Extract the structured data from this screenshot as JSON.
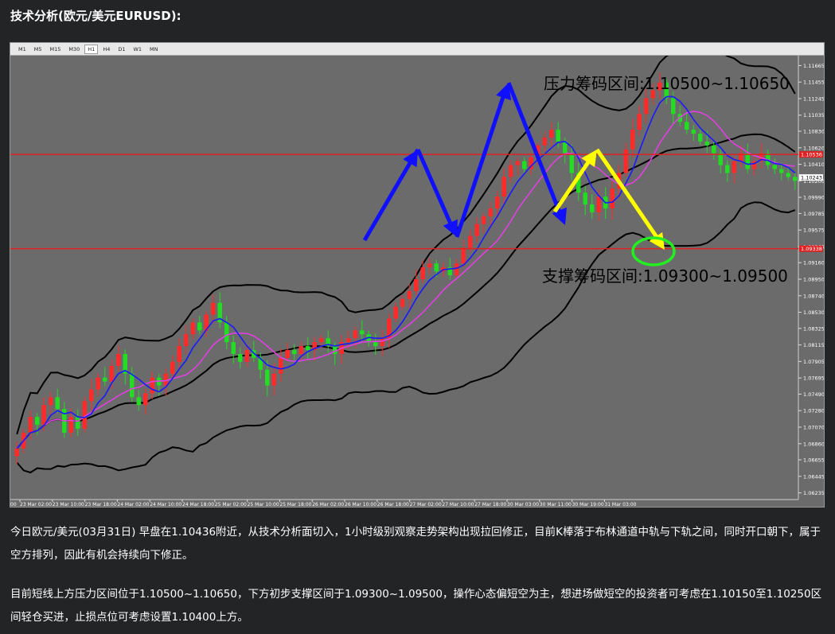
{
  "header": {
    "title": "技术分析(欧元/美元EURUSD):"
  },
  "toolbar": {
    "timeframes": [
      "M1",
      "M5",
      "M15",
      "M30",
      "H1",
      "H4",
      "D1",
      "W1",
      "MN"
    ],
    "active": "H1"
  },
  "chart_data": {
    "type": "candlestick",
    "symbol": "EURUSD",
    "timeframe": "H1",
    "ylim": [
      1.0615,
      1.1175
    ],
    "y_ticks": [
      "1.11665",
      "1.11455",
      "1.11245",
      "1.11035",
      "1.10830",
      "1.10620",
      "1.10410",
      "1.10200",
      "1.09990",
      "1.09785",
      "1.09575",
      "1.09365",
      "1.09160",
      "1.08950",
      "1.08740",
      "1.08530",
      "1.08325",
      "1.08115",
      "1.07905",
      "1.07695",
      "1.07490",
      "1.07280",
      "1.07070",
      "1.06860",
      "1.06655",
      "1.06445",
      "1.06235"
    ],
    "x_ticks": [
      "23 Mar 02:00",
      "23 Mar 10:00",
      "23 Mar 18:00",
      "24 Mar 02:00",
      "24 Mar 10:00",
      "24 Mar 18:00",
      "25 Mar 02:00",
      "25 Mar 10:00",
      "25 Mar 18:00",
      "26 Mar 02:00",
      "26 Mar 10:00",
      "26 Mar 18:00",
      "27 Mar 02:00",
      "27 Mar 10:00",
      "27 Mar 18:00",
      "30 Mar 03:00",
      "30 Mar 11:00",
      "30 Mar 19:00",
      "31 Mar 03:00"
    ],
    "first_x_label_partial": "00",
    "price_tags": [
      {
        "label": "1.10536",
        "value": 1.10536,
        "color": "#e02020"
      },
      {
        "label": "1.10243",
        "value": 1.10243,
        "color": "#ffffff"
      },
      {
        "label": "1.09338",
        "value": 1.09338,
        "color": "#e02020"
      }
    ],
    "horizontal_lines": [
      {
        "value": 1.10536,
        "color": "#e02020"
      },
      {
        "value": 1.09338,
        "color": "#e02020"
      }
    ],
    "resistance_zone": {
      "label": "压力筹码区间:1.10500~1.10650",
      "low": 1.105,
      "high": 1.1065
    },
    "support_zone": {
      "label": "支撑筹码区间:1.09300~1.09500",
      "low": 1.093,
      "high": 1.095
    },
    "closes": [
      1.068,
      1.07,
      1.072,
      1.071,
      1.0735,
      1.0745,
      1.073,
      1.07,
      1.072,
      1.0705,
      1.074,
      1.0755,
      1.077,
      1.0765,
      1.0785,
      1.08,
      1.0775,
      1.0745,
      1.0735,
      1.075,
      1.077,
      1.076,
      1.0775,
      1.079,
      1.081,
      1.0825,
      1.084,
      1.083,
      1.085,
      1.0865,
      1.084,
      1.0815,
      1.08,
      1.079,
      1.0805,
      1.0795,
      1.078,
      1.076,
      1.0775,
      1.0795,
      1.0805,
      1.08,
      1.081,
      1.0805,
      1.0815,
      1.082,
      1.081,
      1.08,
      1.0815,
      1.082,
      1.083,
      1.0825,
      1.0815,
      1.081,
      1.082,
      1.0845,
      1.086,
      1.087,
      1.088,
      1.0895,
      1.091,
      1.0915,
      1.0905,
      1.091,
      1.09,
      1.0915,
      1.0935,
      1.095,
      1.0965,
      1.0975,
      1.0985,
      1.1,
      1.1025,
      1.104,
      1.1045,
      1.1035,
      1.105,
      1.1065,
      1.1075,
      1.1085,
      1.107,
      1.1055,
      1.103,
      1.1005,
      1.099,
      1.098,
      1.1,
      1.0985,
      1.101,
      1.103,
      1.106,
      1.1085,
      1.1105,
      1.1125,
      1.1135,
      1.1145,
      1.1125,
      1.1105,
      1.1095,
      1.1085,
      1.108,
      1.107,
      1.1065,
      1.1055,
      1.104,
      1.103,
      1.1045,
      1.1055,
      1.1035,
      1.1045,
      1.1055,
      1.104,
      1.1035,
      1.103,
      1.1025,
      1.102
    ]
  },
  "paragraphs": {
    "p1": "今日欧元/美元(03月31日) 早盘在1.10436附近，从技术分析面切入，1小时级别观察走势架构出现拉回修正，目前K棒落于布林通道中轨与下轨之间，同时开口朝下，属于空方排列，因此有机会持续向下修正。",
    "p2": "目前短线上方压力区间位于1.10500~1.10650，下方初步支撑区间于1.09300~1.09500，操作心态偏短空为主，想进场做短空的投资者可考虑在1.10150至1.10250区间轻仓买进，止损点位可考虑设置1.10400上方。"
  },
  "colors": {
    "background": "#232426",
    "chart_bg": "#6b6b6b",
    "bull": "#ff2a2a",
    "bear": "#22dd22",
    "fast_ma": "#1a1aff",
    "slow_ma": "#e040e0",
    "bands": "#000000",
    "arrow_blue": "#1010ff",
    "arrow_yellow": "#ffff00",
    "circle": "#22ee22"
  }
}
